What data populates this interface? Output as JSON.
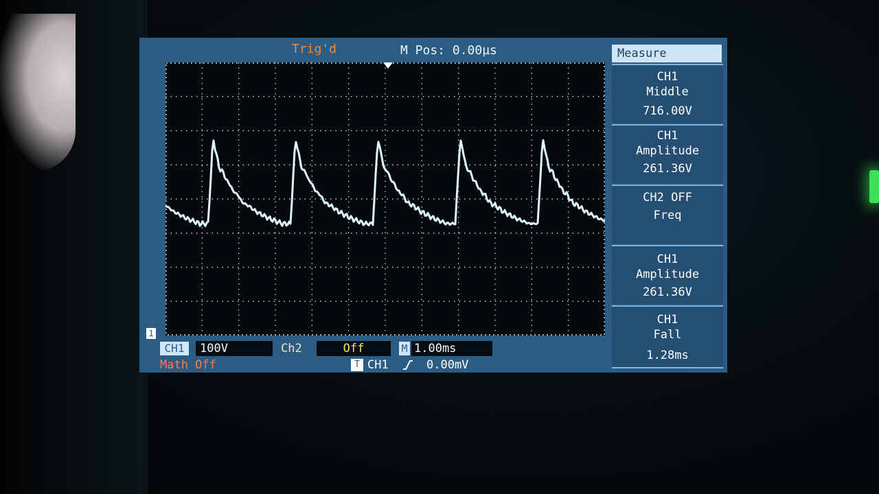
{
  "status": {
    "trigger_state": "Trig'd",
    "horizontal_position": "M Pos: 0.00µs"
  },
  "waveform": {
    "channel": "CH1",
    "color": "#dff4ff"
  },
  "channel_bar": {
    "ch1_label": "CH1",
    "ch1_scale": "100V",
    "ch2_label": "Ch2",
    "ch2_state": "Off",
    "timebase_label": "M",
    "timebase_value": "1.00ms",
    "math": "Math Off",
    "trigger_tag": "T",
    "trigger_source": "CH1",
    "trigger_level": "0.00mV"
  },
  "menu": {
    "title": "Measure",
    "items": [
      {
        "line1": "CH1",
        "line2": "Middle",
        "value": "716.00V"
      },
      {
        "line1": "CH1",
        "line2": "Amplitude",
        "value": "261.36V"
      },
      {
        "line1": "CH2   OFF",
        "line2": "",
        "value": "Freq"
      },
      {
        "line1": "CH1",
        "line2": "Amplitude",
        "value": "261.36V"
      },
      {
        "line1": "CH1",
        "line2": "Fall",
        "value": "1.28ms"
      }
    ]
  },
  "colors": {
    "screen_bg": "#2b5c84",
    "trace": "#dff4ff",
    "trigger_status": "#f08a3a",
    "math_off": "#ff7a55",
    "ch2_state": "#f5e26a"
  }
}
